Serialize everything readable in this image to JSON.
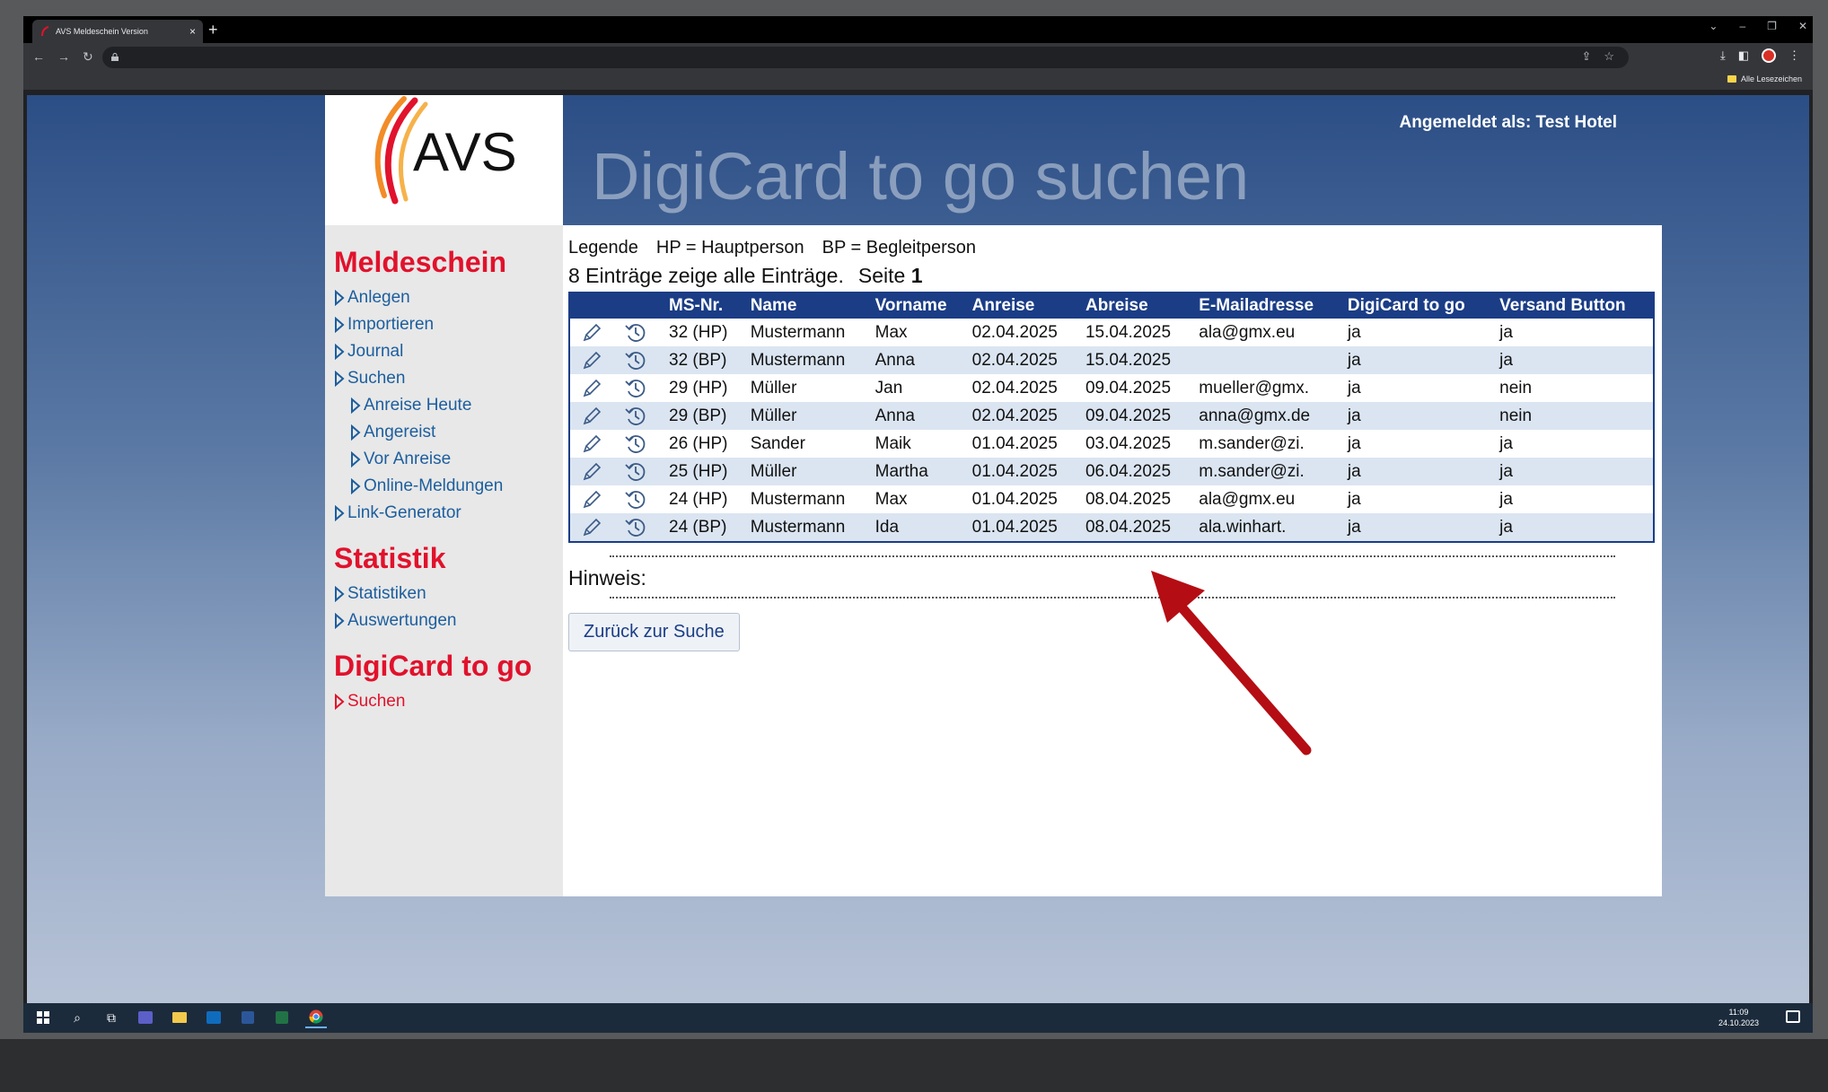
{
  "browser": {
    "tab_title": "AVS Meldeschein Version",
    "tab_close": "×",
    "new_tab": "+",
    "bookmark_label": "Alle Lesezeichen"
  },
  "header": {
    "logo_text": "AVS",
    "logged_in": "Angemeldet als: Test Hotel",
    "title": "DigiCard to go suchen"
  },
  "sidebar": {
    "sections": [
      {
        "heading": "Meldeschein",
        "items": [
          {
            "label": "Anlegen",
            "sub": false
          },
          {
            "label": "Importieren",
            "sub": false
          },
          {
            "label": "Journal",
            "sub": false
          },
          {
            "label": "Suchen",
            "sub": false
          },
          {
            "label": "Anreise Heute",
            "sub": true
          },
          {
            "label": "Angereist",
            "sub": true
          },
          {
            "label": "Vor Anreise",
            "sub": true
          },
          {
            "label": "Online-Meldungen",
            "sub": true
          },
          {
            "label": "Link-Generator",
            "sub": false
          }
        ]
      },
      {
        "heading": "Statistik",
        "items": [
          {
            "label": "Statistiken",
            "sub": false
          },
          {
            "label": "Auswertungen",
            "sub": false
          }
        ]
      },
      {
        "heading": "DigiCard to go",
        "items": [
          {
            "label": "Suchen",
            "sub": false,
            "active": true
          }
        ]
      }
    ]
  },
  "content": {
    "legend": {
      "label": "Legende",
      "hp": "HP = Hauptperson",
      "bp": "BP = Begleitperson"
    },
    "count_text": "8 Einträge zeige alle Einträge.",
    "page_label": "Seite",
    "page_number": "1",
    "table": {
      "columns": [
        "",
        "",
        "MS-Nr.",
        "Name",
        "Vorname",
        "Anreise",
        "Abreise",
        "E-Mailadresse",
        "DigiCard to go",
        "Versand Button"
      ],
      "rows": [
        [
          "32 (HP)",
          "Mustermann",
          "Max",
          "02.04.2025",
          "15.04.2025",
          "ala@gmx.eu",
          "ja",
          "ja"
        ],
        [
          "32 (BP)",
          "Mustermann",
          "Anna",
          "02.04.2025",
          "15.04.2025",
          "",
          "ja",
          "ja"
        ],
        [
          "29 (HP)",
          "Müller",
          "Jan",
          "02.04.2025",
          "09.04.2025",
          "mueller@gmx.",
          "ja",
          "nein"
        ],
        [
          "29 (BP)",
          "Müller",
          "Anna",
          "02.04.2025",
          "09.04.2025",
          "anna@gmx.de",
          "ja",
          "nein"
        ],
        [
          "26 (HP)",
          "Sander",
          "Maik",
          "01.04.2025",
          "03.04.2025",
          "m.sander@zi.",
          "ja",
          "ja"
        ],
        [
          "25 (HP)",
          "Müller",
          "Martha",
          "01.04.2025",
          "06.04.2025",
          "m.sander@zi.",
          "ja",
          "ja"
        ],
        [
          "24 (HP)",
          "Mustermann",
          "Max",
          "01.04.2025",
          "08.04.2025",
          "ala@gmx.eu",
          "ja",
          "ja"
        ],
        [
          "24 (BP)",
          "Mustermann",
          "Ida",
          "01.04.2025",
          "08.04.2025",
          "ala.winhart.",
          "ja",
          "ja"
        ]
      ]
    },
    "hint_label": "Hinweis:",
    "back_button": "Zurück zur Suche"
  },
  "taskbar": {
    "time": "11:09",
    "date": "24.10.2023"
  },
  "colors": {
    "accent_red": "#e1122c",
    "link_blue": "#1c5e9e",
    "table_header": "#1b3d86",
    "row_alt": "#dbe5f1",
    "arrow": "#b50d14"
  }
}
